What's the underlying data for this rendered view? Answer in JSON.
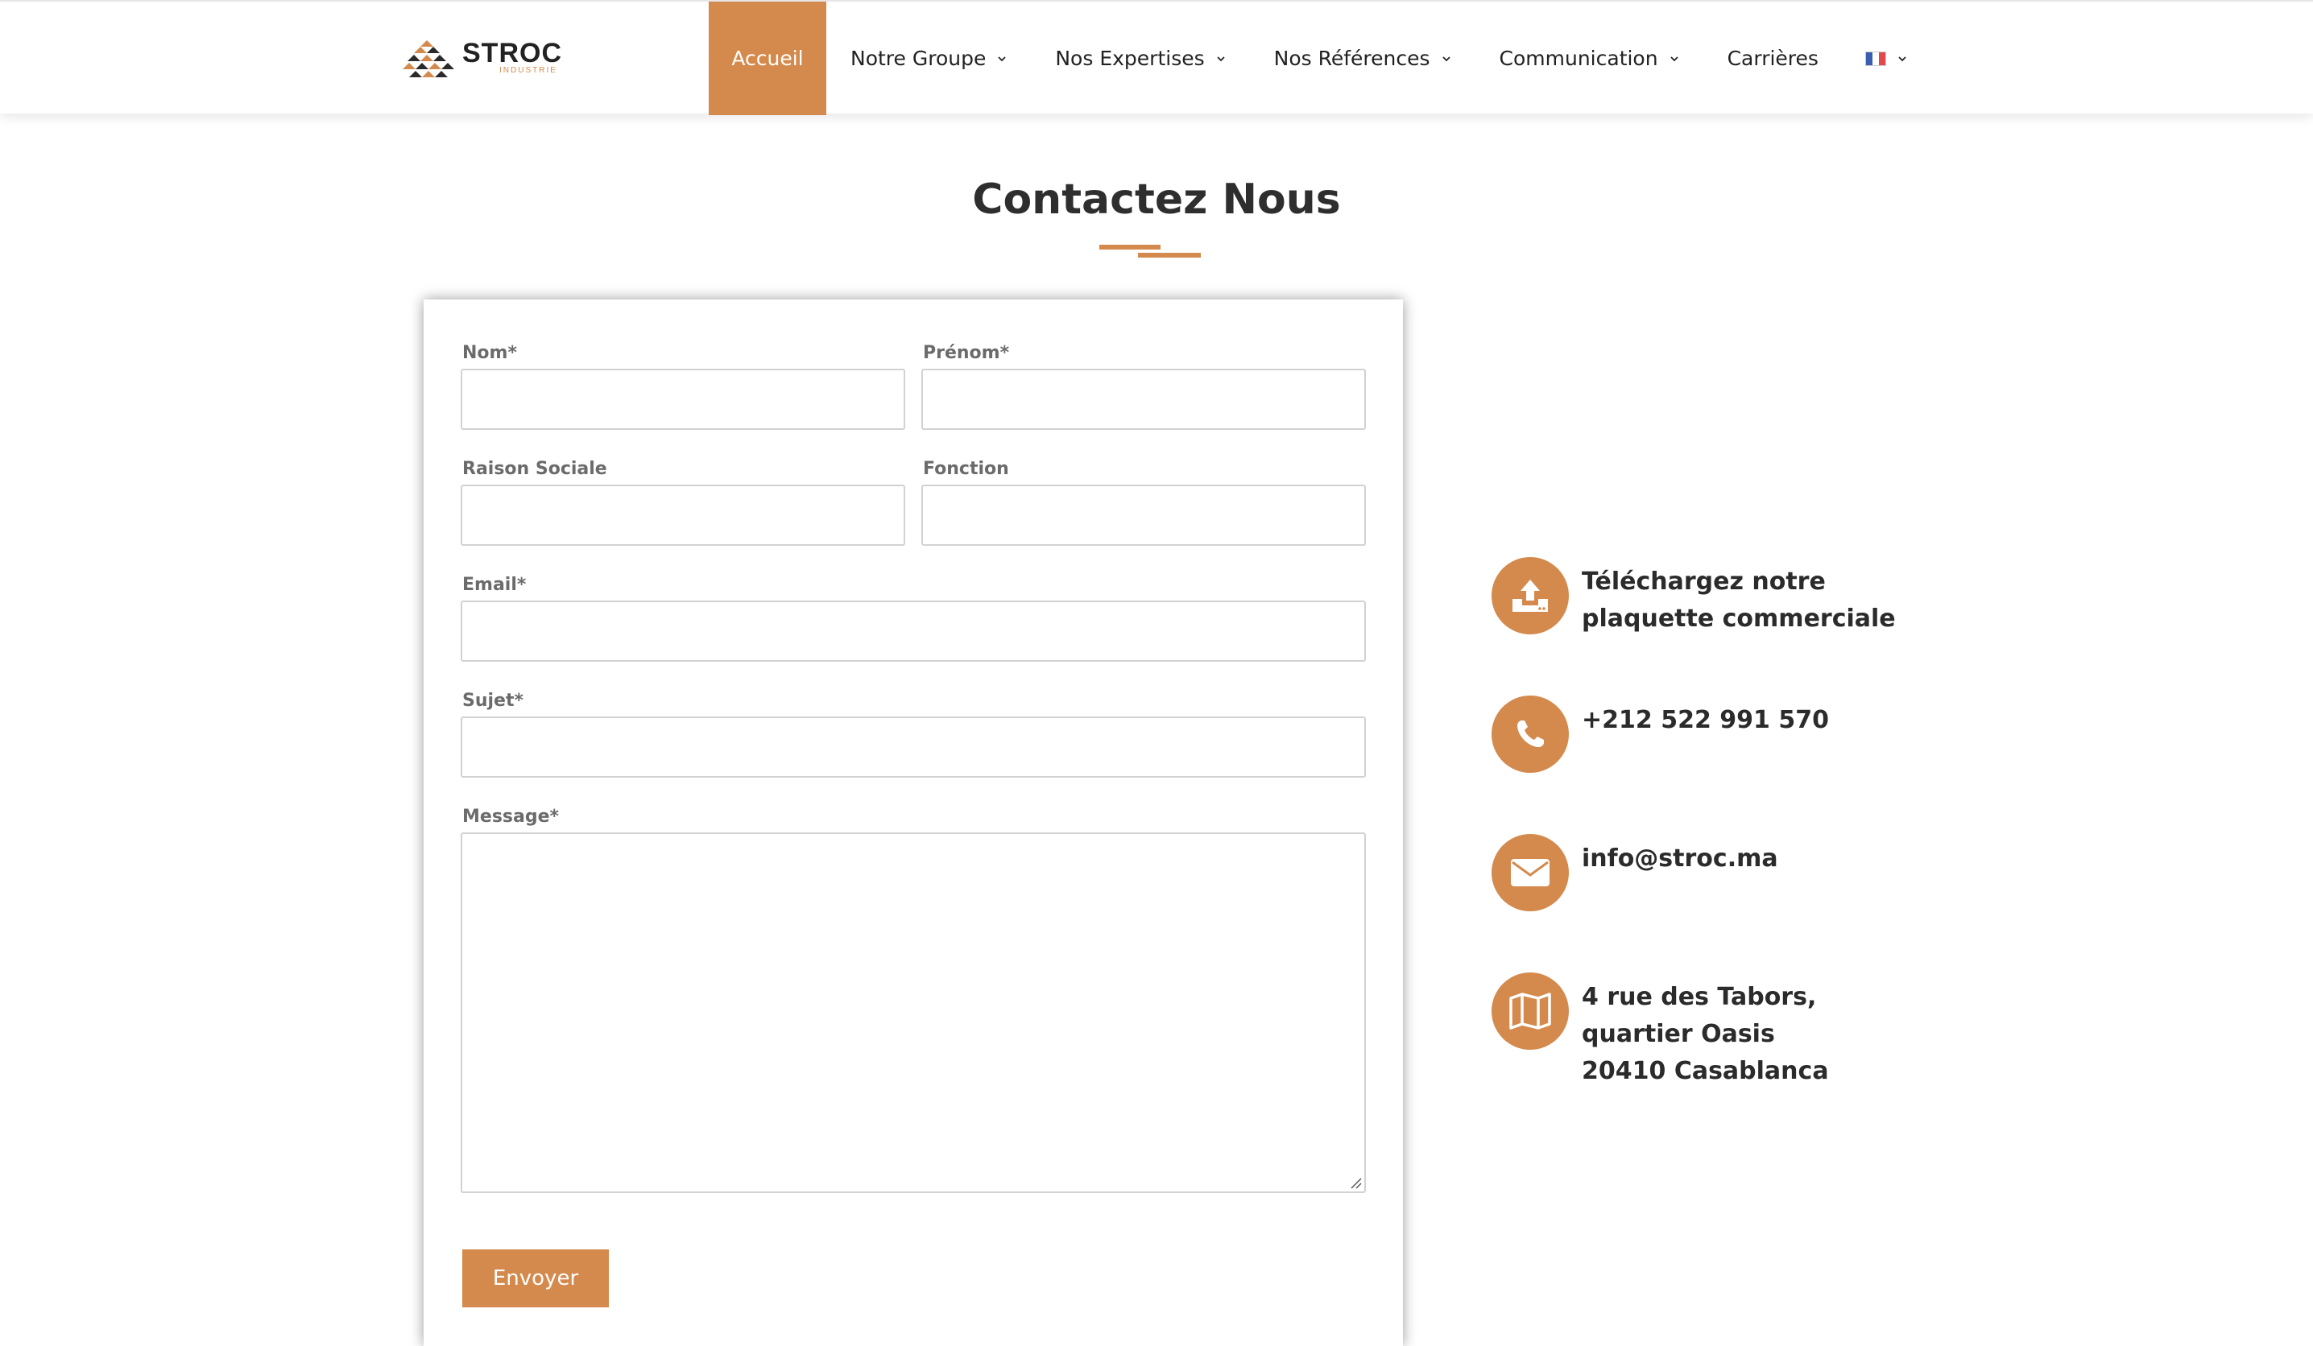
{
  "header": {
    "logo": {
      "name": "STROC",
      "subtitle": "INDUSTRIE"
    },
    "nav": [
      {
        "label": "Accueil",
        "active": true,
        "dropdown": false
      },
      {
        "label": "Notre Groupe",
        "active": false,
        "dropdown": true
      },
      {
        "label": "Nos Expertises",
        "active": false,
        "dropdown": true
      },
      {
        "label": "Nos Références",
        "active": false,
        "dropdown": true
      },
      {
        "label": "Communication",
        "active": false,
        "dropdown": true
      },
      {
        "label": "Carrières",
        "active": false,
        "dropdown": false
      }
    ],
    "language": {
      "flag": "france-flag-icon",
      "dropdown": true
    }
  },
  "page": {
    "title": "Contactez Nous"
  },
  "form": {
    "fields": {
      "nom": {
        "label": "Nom*",
        "value": ""
      },
      "prenom": {
        "label": "Prénom*",
        "value": ""
      },
      "raison_sociale": {
        "label": "Raison Sociale",
        "value": ""
      },
      "fonction": {
        "label": "Fonction",
        "value": ""
      },
      "email": {
        "label": "Email*",
        "value": ""
      },
      "sujet": {
        "label": "Sujet*",
        "value": ""
      },
      "message": {
        "label": "Message*",
        "value": ""
      }
    },
    "submit_label": "Envoyer"
  },
  "contact": {
    "brochure": {
      "icon": "upload-tray-icon",
      "lines": [
        "Téléchargez notre",
        "plaquette commerciale"
      ]
    },
    "phone": {
      "icon": "phone-icon",
      "lines": [
        "+212 522 991 570"
      ]
    },
    "email": {
      "icon": "envelope-icon",
      "lines": [
        "info@stroc.ma"
      ]
    },
    "address": {
      "icon": "map-icon",
      "lines": [
        "4 rue des Tabors,",
        "quartier Oasis",
        "20410 Casablanca"
      ]
    }
  },
  "colors": {
    "accent": "#d48a4c",
    "text": "#2b2b2b",
    "label": "#6b6b6b",
    "border": "#d2d2d2"
  }
}
